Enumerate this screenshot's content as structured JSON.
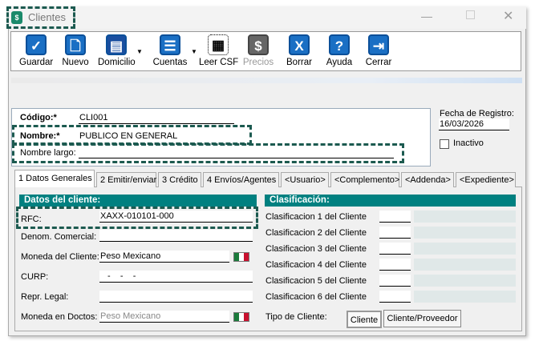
{
  "window": {
    "title": "Clientes",
    "app_icon": "$"
  },
  "toolbar": [
    {
      "label": "Guardar",
      "icon": "✓"
    },
    {
      "label": "Nuevo",
      "icon": "🗋"
    },
    {
      "label": "Domicilio",
      "icon": "▤"
    },
    {
      "label": "Cuentas",
      "icon": "☰"
    },
    {
      "label": "Leer CSF",
      "icon": "▦"
    },
    {
      "label": "Precios",
      "icon": "$"
    },
    {
      "label": "Borrar",
      "icon": "X"
    },
    {
      "label": "Ayuda",
      "icon": "?"
    },
    {
      "label": "Cerrar",
      "icon": "⇥"
    }
  ],
  "header": {
    "codigo_label": "Código:*",
    "codigo": "CLI001",
    "nombre_label": "Nombre:*",
    "nombre": "PUBLICO EN GENERAL",
    "nombre_largo_label": "Nombre largo:",
    "nombre_largo": "",
    "fecha_label": "Fecha de Registro:",
    "fecha": "16/03/2026",
    "inactivo_label": "Inactivo"
  },
  "tabs": [
    "1 Datos Generales",
    "2 Emitir/enviar",
    "3 Crédito",
    "4 Envíos/Agentes",
    "<Usuario>",
    "<Complemento>",
    "<Addenda>",
    "<Expediente>"
  ],
  "datos": {
    "title": "Datos del cliente:",
    "rfc_label": "RFC:",
    "rfc": "XAXX-010101-000",
    "denom_label": "Denom. Comercial:",
    "denom": "",
    "moneda_label": "Moneda del Cliente:",
    "moneda": "Peso Mexicano",
    "curp_label": "CURP:",
    "curp": "-    -    -",
    "repr_label": "Repr. Legal:",
    "repr": "",
    "moneda_doc_label": "Moneda en Doctos:",
    "moneda_doc": "Peso Mexicano"
  },
  "clasificacion": {
    "title": "Clasificación:",
    "items": [
      "Clasificacion 1 del Cliente",
      "Clasificacion 2 del Cliente",
      "Clasificacion 3 del Cliente",
      "Clasificacion 4 del Cliente",
      "Clasificacion 5 del Cliente",
      "Clasificacion 6 del Cliente"
    ],
    "tipo_label": "Tipo de Cliente:",
    "tipo_options": [
      "Cliente",
      "Cliente/Proveedor"
    ]
  }
}
